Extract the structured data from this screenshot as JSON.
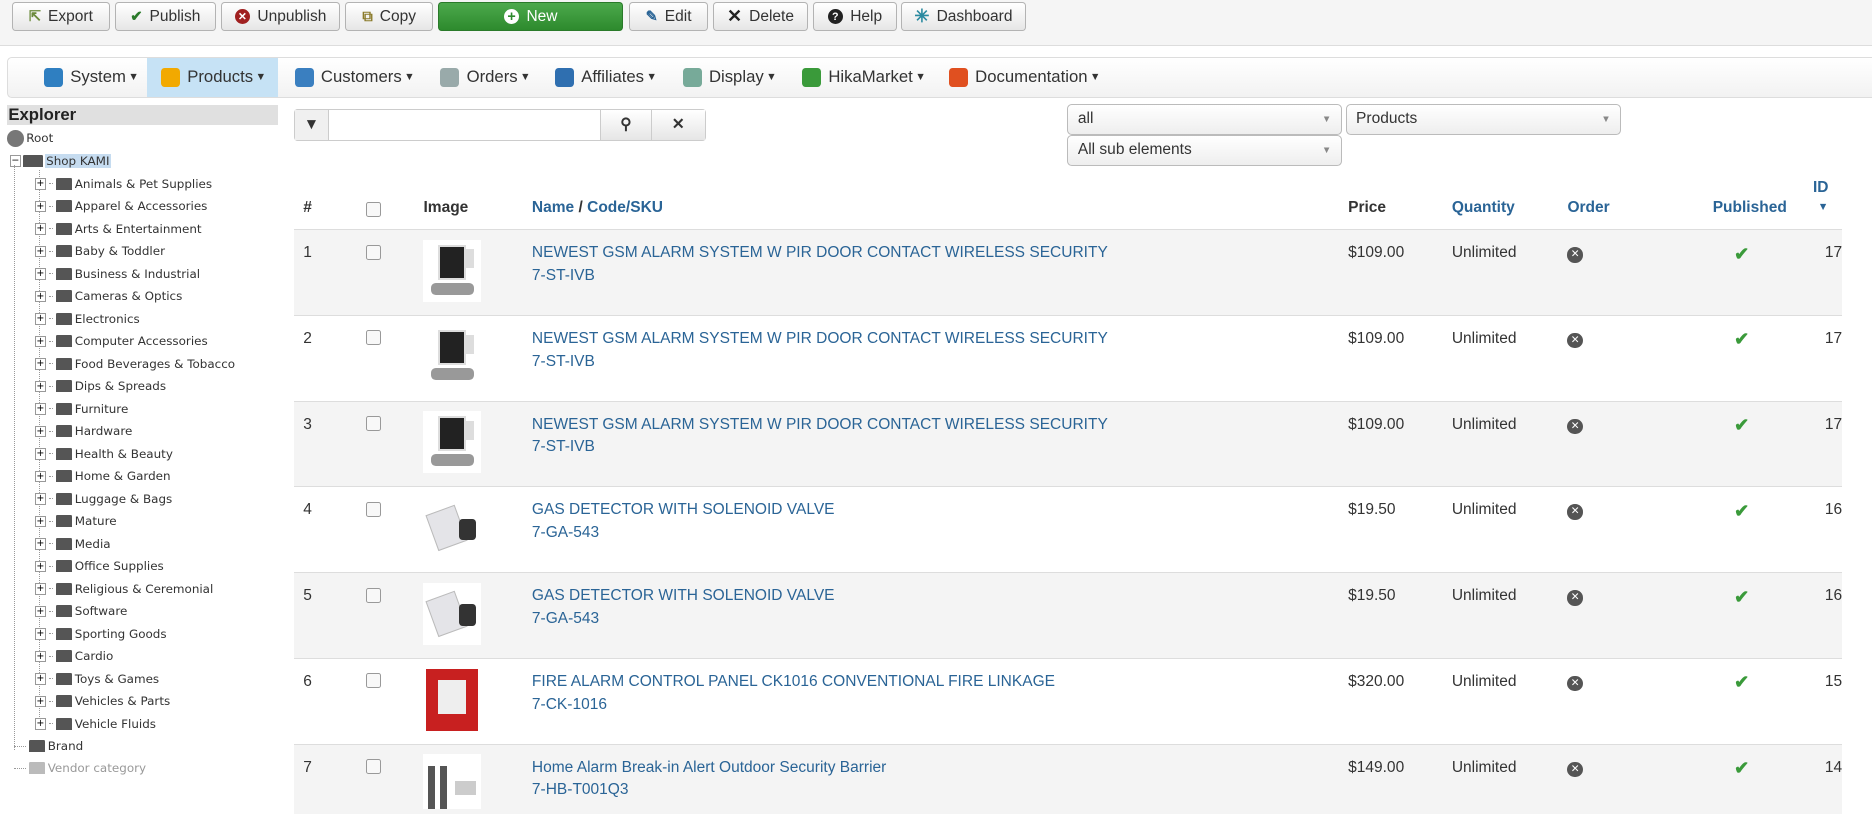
{
  "toolbar": {
    "export": "Export",
    "publish": "Publish",
    "unpublish": "Unpublish",
    "copy": "Copy",
    "new": "New",
    "edit": "Edit",
    "delete": "Delete",
    "help": "Help",
    "dashboard": "Dashboard"
  },
  "menu": [
    {
      "label": "System",
      "color": "#2f7fc1"
    },
    {
      "label": "Products",
      "color": "#f2a900"
    },
    {
      "label": "Customers",
      "color": "#3a7fc0"
    },
    {
      "label": "Orders",
      "color": "#9aa"
    },
    {
      "label": "Affiliates",
      "color": "#2f6fb0"
    },
    {
      "label": "Display",
      "color": "#7a9"
    },
    {
      "label": "HikaMarket",
      "color": "#3a9a3a"
    },
    {
      "label": "Documentation",
      "color": "#e05020"
    }
  ],
  "explorer": {
    "title": "Explorer",
    "root": "Root",
    "shop": "Shop KAMI",
    "categories": [
      "Animals & Pet Supplies",
      "Apparel & Accessories",
      "Arts & Entertainment",
      "Baby & Toddler",
      "Business & Industrial",
      "Cameras & Optics",
      "Electronics",
      "Computer Accessories",
      "Food Beverages & Tobacco",
      "Dips & Spreads",
      "Furniture",
      "Hardware",
      "Health & Beauty",
      "Home & Garden",
      "Luggage & Bags",
      "Mature",
      "Media",
      "Office Supplies",
      "Religious & Ceremonial",
      "Software",
      "Sporting Goods",
      "Cardio",
      "Toys & Games",
      "Vehicles & Parts",
      "Vehicle Fluids"
    ],
    "brand": "Brand",
    "vendor": "Vendor category"
  },
  "filters": {
    "search_value": "",
    "select1": "all",
    "select2": "Products",
    "select3": "All sub elements"
  },
  "table": {
    "headers": {
      "num": "#",
      "image": "Image",
      "name": "Name",
      "code": "Code/SKU",
      "price": "Price",
      "quantity": "Quantity",
      "order": "Order",
      "published": "Published",
      "id": "ID"
    },
    "rows": [
      {
        "num": "1",
        "name": "NEWEST GSM ALARM SYSTEM W PIR DOOR CONTACT WIRELESS SECURITY",
        "code": "7-ST-IVB",
        "price": "$109.00",
        "quantity": "Unlimited",
        "id": "17"
      },
      {
        "num": "2",
        "name": "NEWEST GSM ALARM SYSTEM W PIR DOOR CONTACT WIRELESS SECURITY",
        "code": "7-ST-IVB",
        "price": "$109.00",
        "quantity": "Unlimited",
        "id": "17"
      },
      {
        "num": "3",
        "name": "NEWEST GSM ALARM SYSTEM W PIR DOOR CONTACT WIRELESS SECURITY",
        "code": "7-ST-IVB",
        "price": "$109.00",
        "quantity": "Unlimited",
        "id": "17"
      },
      {
        "num": "4",
        "name": "GAS DETECTOR WITH SOLENOID VALVE",
        "code": "7-GA-543",
        "price": "$19.50",
        "quantity": "Unlimited",
        "id": "16"
      },
      {
        "num": "5",
        "name": "GAS DETECTOR WITH SOLENOID VALVE",
        "code": "7-GA-543",
        "price": "$19.50",
        "quantity": "Unlimited",
        "id": "16"
      },
      {
        "num": "6",
        "name": "FIRE ALARM CONTROL PANEL CK1016 CONVENTIONAL FIRE LINKAGE",
        "code": "7-CK-1016",
        "price": "$320.00",
        "quantity": "Unlimited",
        "id": "15"
      },
      {
        "num": "7",
        "name": "Home Alarm Break-in Alert Outdoor Security Barrier",
        "code": "7-HB-T001Q3",
        "price": "$149.00",
        "quantity": "Unlimited",
        "id": "14"
      }
    ]
  }
}
